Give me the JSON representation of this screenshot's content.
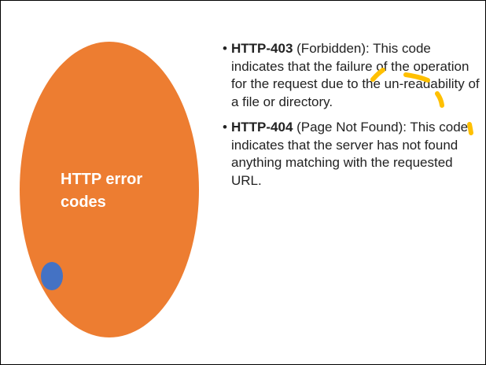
{
  "circle_title_line1": "HTTP error",
  "circle_title_line2": "codes",
  "items": [
    {
      "bullet": "•",
      "term": "HTTP-403",
      "text": " (Forbidden): This code indicates that the failure of the operation for the request due to the un-readability of a file or directory."
    },
    {
      "bullet": "•",
      "term": "HTTP-404",
      "text": " (Page Not Found): This code indicates that the server has not found anything matching with the requested URL."
    }
  ],
  "colors": {
    "circle": "#ED7D31",
    "dot": "#4472C4",
    "highlighter": "#FFC000"
  }
}
